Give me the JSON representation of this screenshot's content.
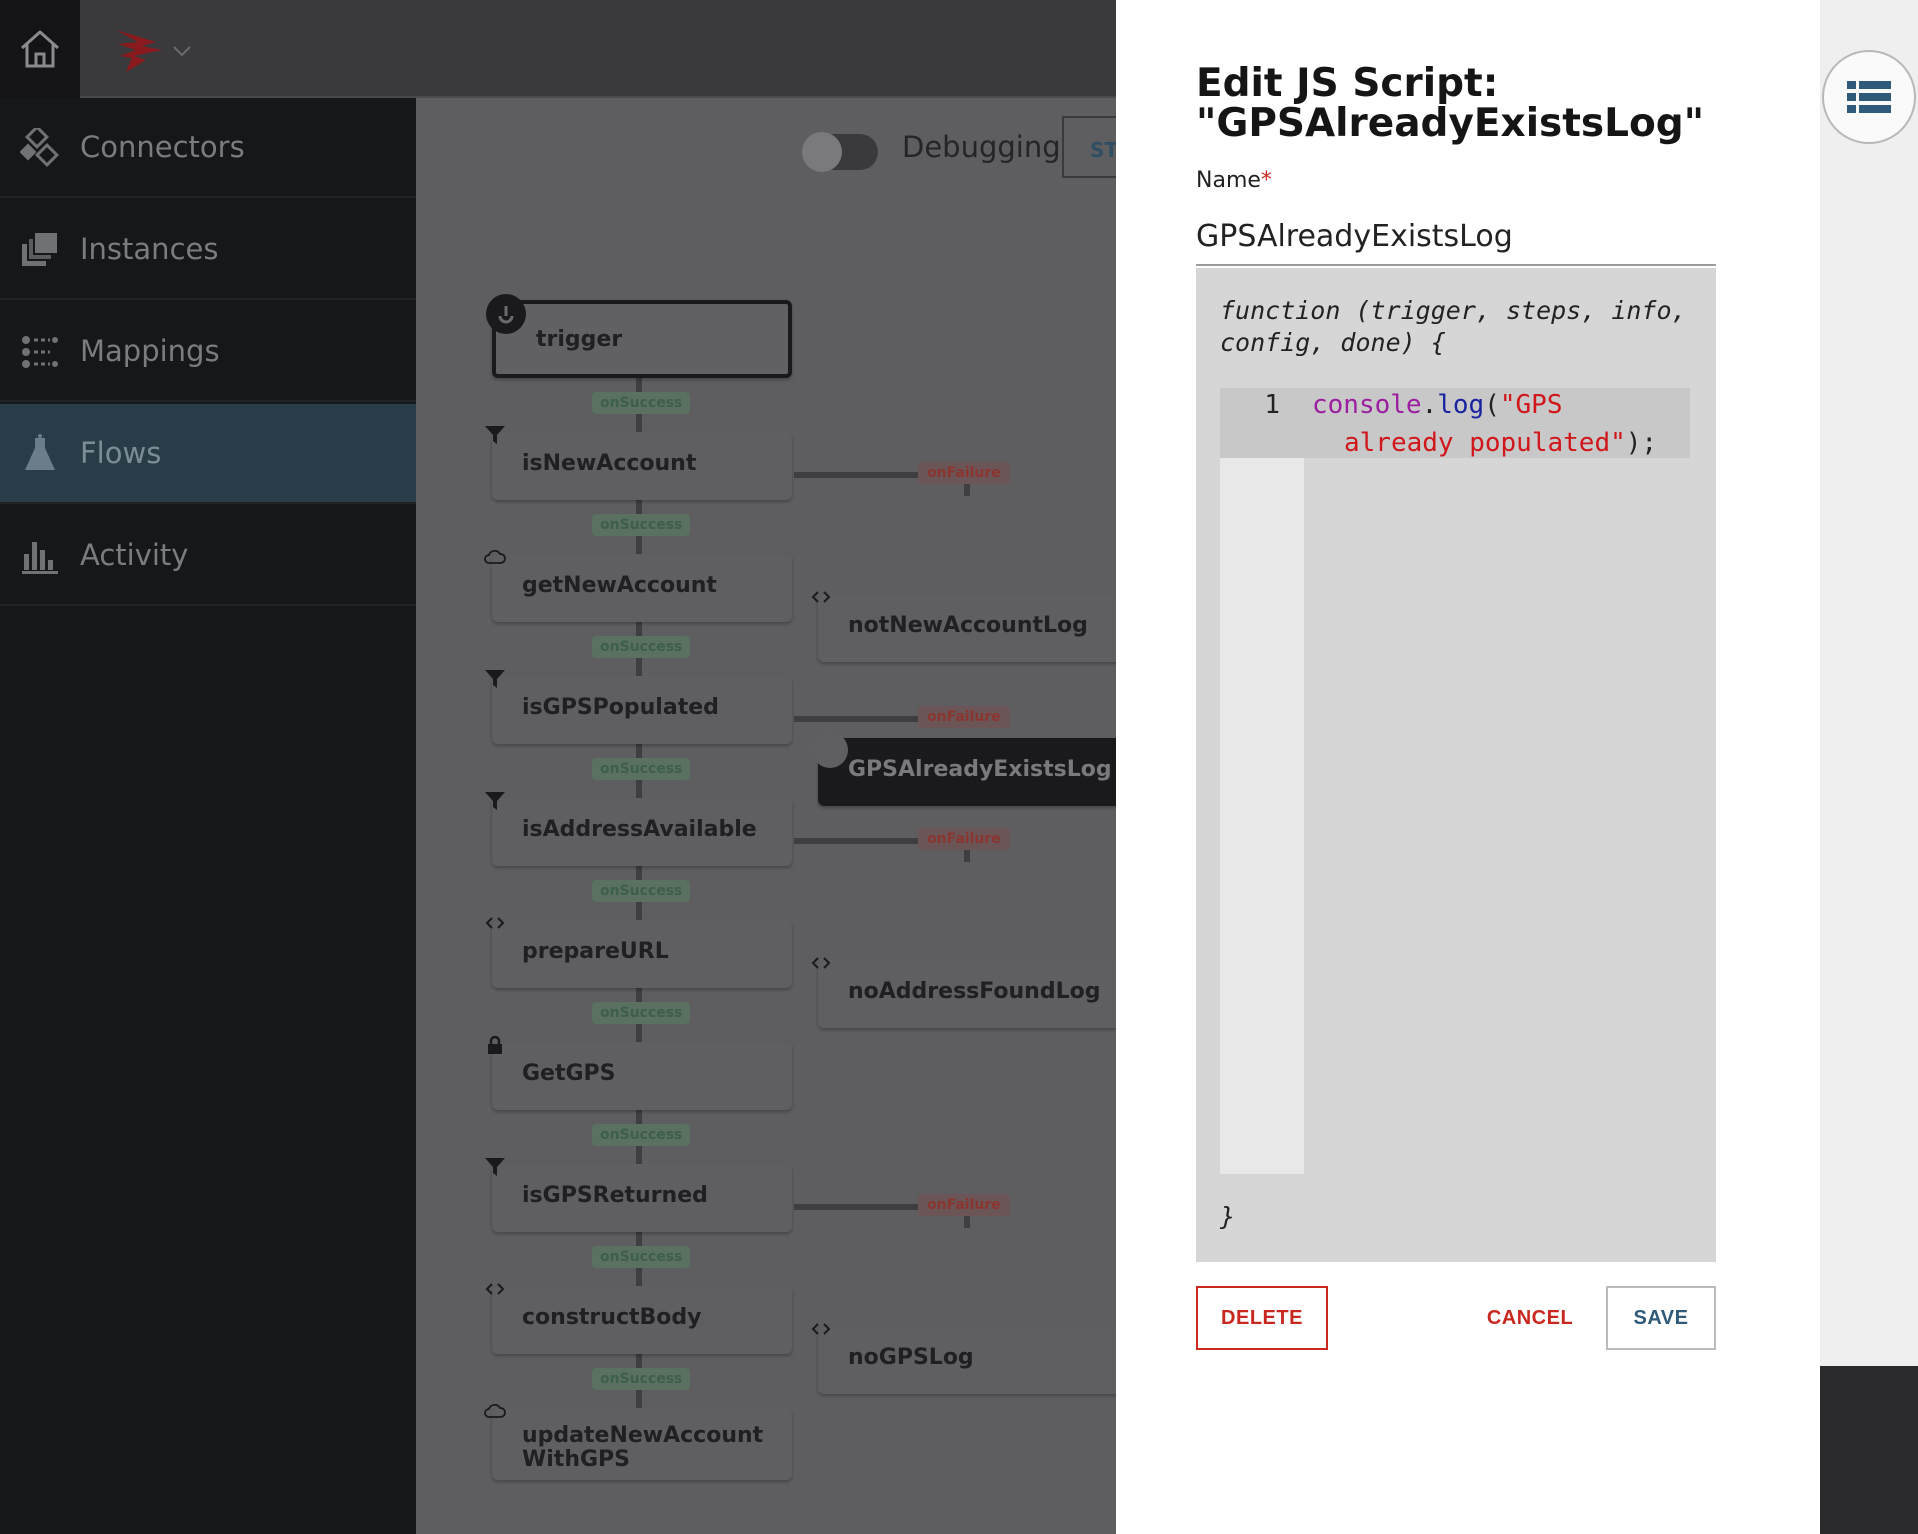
{
  "sidebar": {
    "items": [
      {
        "label": "Connectors"
      },
      {
        "label": "Instances"
      },
      {
        "label": "Mappings"
      },
      {
        "label": "Flows"
      },
      {
        "label": "Activity"
      }
    ]
  },
  "toolbar": {
    "debugging_label": "Debugging",
    "start_label": "ST"
  },
  "flow": {
    "nodes": [
      {
        "label": "trigger"
      },
      {
        "label": "isNewAccount"
      },
      {
        "label": "getNewAccount"
      },
      {
        "label": "isGPSPopulated"
      },
      {
        "label": "isAddressAvailable"
      },
      {
        "label": "prepareURL"
      },
      {
        "label": "GetGPS"
      },
      {
        "label": "isGPSReturned"
      },
      {
        "label": "constructBody"
      },
      {
        "label": "updateNewAccountWithGPS"
      },
      {
        "label": "notNewAccountLog"
      },
      {
        "label": "GPSAlreadyExistsLog"
      },
      {
        "label": "noAddressFoundLog"
      },
      {
        "label": "noGPSLog"
      }
    ],
    "on_success": "onSuccess",
    "on_failure": "onFailure"
  },
  "panel": {
    "title": "Edit JS Script: \"GPSAlreadyExistsLog\"",
    "name_label": "Name",
    "name_required_mark": "*",
    "name_value": "GPSAlreadyExistsLog",
    "signature_line1": "function (trigger, steps, info,",
    "signature_line2": "config, done) {",
    "line_number": "1",
    "code_keyword": "console",
    "code_dot": ".",
    "code_fn": "log",
    "code_open": "(",
    "code_string_1": "\"GPS",
    "code_string_2": "already populated\"",
    "code_close": ");",
    "closing_brace": "}",
    "delete_label": "DELETE",
    "cancel_label": "CANCEL",
    "save_label": "SAVE"
  },
  "icons": {
    "home": "home-icon",
    "logo": "brand-logo-icon",
    "list": "list-view-icon"
  },
  "colors": {
    "accent_red": "#c8281f",
    "accent_blue": "#2f5a7a",
    "sidebar_active": "#283d47"
  }
}
